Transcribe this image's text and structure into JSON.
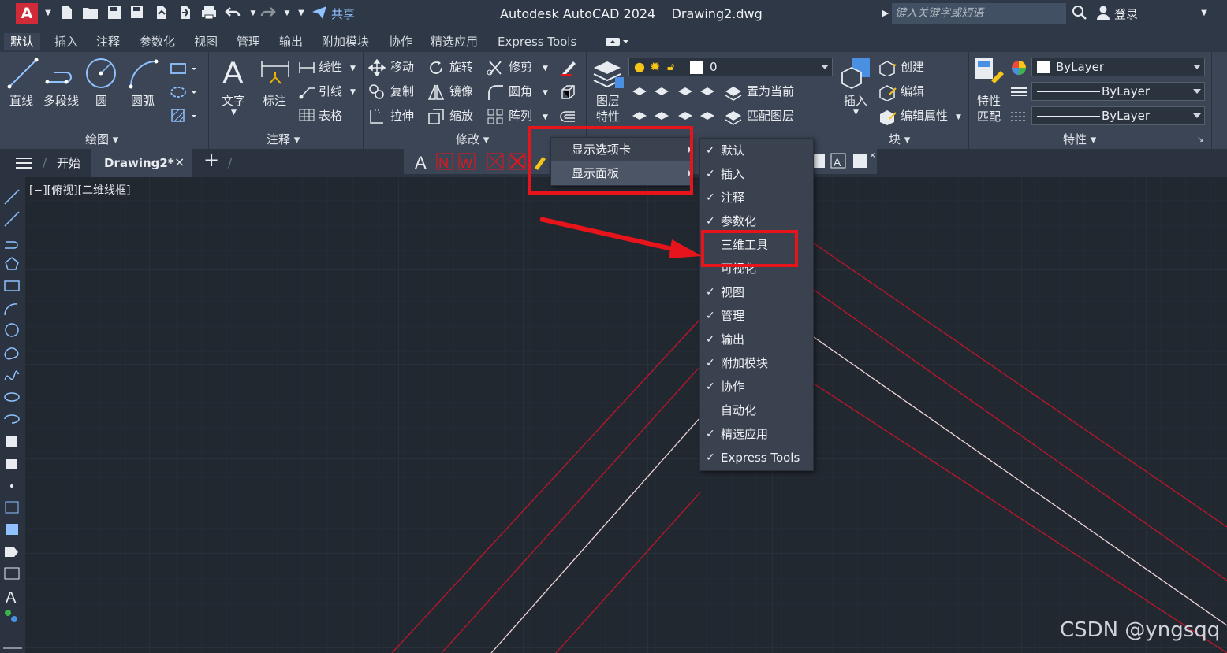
{
  "titlebar": {
    "logo_letter": "A",
    "share_label": "共享",
    "window_title": "Autodesk AutoCAD 2024    Drawing2.dwg",
    "search_placeholder": "键入关键字或短语",
    "login_label": "登录"
  },
  "ribbon_tabs": [
    "默认",
    "插入",
    "注释",
    "参数化",
    "视图",
    "管理",
    "输出",
    "附加模块",
    "协作",
    "精选应用",
    "Express Tools"
  ],
  "ribbon": {
    "draw": {
      "line": "直线",
      "polyline": "多段线",
      "circle": "圆",
      "arc": "圆弧",
      "title": "绘图"
    },
    "annotation": {
      "text": "文字",
      "dimension": "标注",
      "linear": "线性",
      "leader": "引线",
      "table": "表格",
      "title": "注释"
    },
    "modify": {
      "move": "移动",
      "rotate": "旋转",
      "trim": "修剪",
      "copy": "复制",
      "mirror": "镜像",
      "fillet": "圆角",
      "stretch": "拉伸",
      "scale": "缩放",
      "array": "阵列",
      "title": "修改"
    },
    "layers": {
      "layer_props_line1": "图层",
      "layer_props_line2": "特性",
      "current_layer": "0",
      "make_current": "置为当前",
      "match_layer": "匹配图层"
    },
    "block": {
      "insert": "插入",
      "create": "创建",
      "edit": "编辑",
      "edit_attributes": "编辑属性",
      "title": "块"
    },
    "properties": {
      "match_line1": "特性",
      "match_line2": "匹配",
      "color": "ByLayer",
      "linetype": "ByLayer",
      "lineweight": "ByLayer",
      "title": "特性"
    }
  },
  "file_tabs": {
    "start": "开始",
    "drawing": "Drawing2*"
  },
  "viewport_label": "[−][俯视][二维线框]",
  "context_menu": {
    "items": [
      "显示选项卡",
      "显示面板"
    ],
    "highlighted": 1
  },
  "submenu": {
    "items": [
      {
        "label": "默认",
        "checked": true
      },
      {
        "label": "插入",
        "checked": true
      },
      {
        "label": "注释",
        "checked": true
      },
      {
        "label": "参数化",
        "checked": true
      },
      {
        "label": "三维工具",
        "checked": false
      },
      {
        "label": "可视化",
        "checked": false
      },
      {
        "label": "视图",
        "checked": true
      },
      {
        "label": "管理",
        "checked": true
      },
      {
        "label": "输出",
        "checked": true
      },
      {
        "label": "附加模块",
        "checked": true
      },
      {
        "label": "协作",
        "checked": true
      },
      {
        "label": "自动化",
        "checked": false
      },
      {
        "label": "精选应用",
        "checked": true
      },
      {
        "label": "Express Tools",
        "checked": true
      }
    ]
  },
  "watermark": "CSDN @yngsqq",
  "colors": {
    "annotation_red": "#e8141c",
    "canvas": "#212830",
    "ribbon": "#3b4555"
  }
}
